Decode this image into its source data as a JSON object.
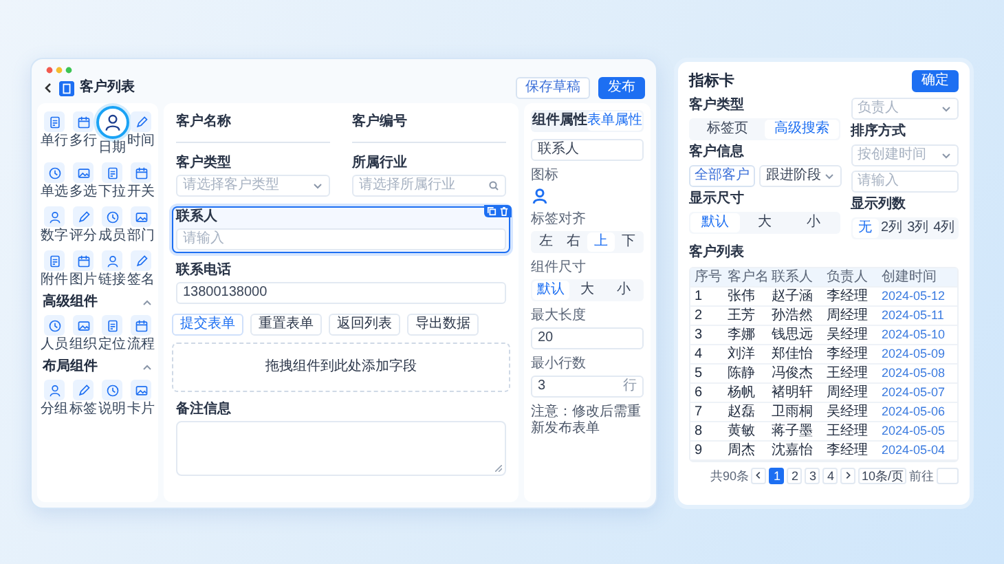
{
  "window": {
    "title": "客户列表",
    "buttons": [
      {
        "label": "保存草稿",
        "kind": "outline"
      },
      {
        "label": "发布",
        "kind": "primary"
      }
    ]
  },
  "palette": {
    "groups": [
      {
        "items": [
          {
            "label": "单行",
            "selected": false
          },
          {
            "label": "多行",
            "selected": false
          },
          {
            "label": "日期",
            "selected": true
          },
          {
            "label": "时间",
            "selected": false
          },
          {
            "label": "单选",
            "selected": false
          },
          {
            "label": "多选",
            "selected": false
          },
          {
            "label": "下拉",
            "selected": false
          },
          {
            "label": "开关",
            "selected": false
          },
          {
            "label": "数字",
            "selected": false
          },
          {
            "label": "评分",
            "selected": false
          },
          {
            "label": "成员",
            "selected": false
          },
          {
            "label": "部门",
            "selected": false
          },
          {
            "label": "附件",
            "selected": false
          },
          {
            "label": "图片",
            "selected": false
          },
          {
            "label": "链接",
            "selected": false
          },
          {
            "label": "签名",
            "selected": false
          }
        ]
      },
      {
        "title": "高级组件",
        "expanded": true,
        "items": [
          {
            "label": "人员",
            "selected": false
          },
          {
            "label": "组织",
            "selected": false
          },
          {
            "label": "定位",
            "selected": false
          },
          {
            "label": "流程",
            "selected": false
          }
        ]
      },
      {
        "title": "布局组件",
        "expanded": true,
        "items": [
          {
            "label": "分组",
            "selected": false
          },
          {
            "label": "标签",
            "selected": false
          },
          {
            "label": "说明",
            "selected": false
          },
          {
            "label": "卡片",
            "selected": false
          }
        ]
      }
    ]
  },
  "form": {
    "rows": [
      {
        "fields": [
          {
            "kind": "line",
            "label": "客户名称",
            "selected": false
          },
          {
            "kind": "line",
            "label": "客户编号",
            "selected": false
          }
        ]
      },
      {
        "fields": [
          {
            "kind": "select",
            "label": "客户类型",
            "placeholder": "请选择客户类型",
            "selected": false
          },
          {
            "kind": "search",
            "label": "所属行业",
            "placeholder": "请选择所属行业",
            "selected": false
          }
        ]
      },
      {
        "fields": [
          {
            "kind": "input",
            "label": "联系人",
            "placeholder": "请输入",
            "selected": true
          }
        ]
      },
      {
        "fields": [
          {
            "kind": "input",
            "label": "联系电话",
            "value": "13800138000",
            "selected": false
          }
        ]
      }
    ],
    "actions": [
      {
        "label": "提交表单",
        "selected": true
      },
      {
        "label": "重置表单",
        "selected": false
      },
      {
        "label": "返回列表",
        "selected": false
      },
      {
        "label": "导出数据",
        "selected": false
      }
    ],
    "drop_hint": "拖拽组件到此处添加字段",
    "textarea": {
      "label": "备注信息"
    }
  },
  "properties": {
    "tabs": [
      {
        "label": "组件属性",
        "selected": false
      },
      {
        "label": "表单属性",
        "selected": true
      }
    ],
    "items": [
      {
        "kind": "input",
        "value": "联系人"
      },
      {
        "kind": "icon",
        "label": "图标"
      },
      {
        "kind": "segmented",
        "label": "标签对齐",
        "options": [
          {
            "label": "左",
            "selected": false
          },
          {
            "label": "右",
            "selected": false
          },
          {
            "label": "上",
            "selected": true
          },
          {
            "label": "下",
            "selected": false
          }
        ]
      },
      {
        "kind": "segmented",
        "label": "组件尺寸",
        "options": [
          {
            "label": "默认",
            "selected": true
          },
          {
            "label": "大",
            "selected": false
          },
          {
            "label": "小",
            "selected": false
          }
        ]
      },
      {
        "kind": "input",
        "label": "最大长度",
        "value": "20"
      },
      {
        "kind": "stepper",
        "label": "最小行数",
        "value": "3",
        "unit": "行"
      },
      {
        "kind": "note",
        "text": "注意：修改后需重新发布表单"
      }
    ]
  },
  "card": {
    "title": "指标卡",
    "button": "确定",
    "left": [
      {
        "kind": "label",
        "text": "客户类型"
      },
      {
        "kind": "segmented",
        "options": [
          {
            "label": "标签页",
            "selected": false
          },
          {
            "label": "高级搜索",
            "selected": true
          }
        ]
      },
      {
        "kind": "label",
        "text": "客户信息"
      },
      {
        "kind": "pair",
        "button": "全部客户",
        "select": "跟进阶段"
      },
      {
        "kind": "label",
        "text": "显示尺寸"
      },
      {
        "kind": "segmented",
        "options": [
          {
            "label": "默认",
            "selected": true
          },
          {
            "label": "大",
            "selected": false
          },
          {
            "label": "小",
            "selected": false
          }
        ]
      }
    ],
    "right": [
      {
        "kind": "select",
        "placeholder": "负责人"
      },
      {
        "kind": "label",
        "text": "排序方式"
      },
      {
        "kind": "select",
        "placeholder": "按创建时间"
      },
      {
        "kind": "input",
        "placeholder": "请输入"
      },
      {
        "kind": "label",
        "text": "显示列数"
      },
      {
        "kind": "segmented",
        "options": [
          {
            "label": "无",
            "selected": true
          },
          {
            "label": "2列",
            "selected": false
          },
          {
            "label": "3列",
            "selected": false
          },
          {
            "label": "4列",
            "selected": false
          }
        ]
      }
    ],
    "table_title": "客户列表",
    "columns": [
      "序号",
      "客户名",
      "联系人",
      "负责人",
      "创建时间"
    ],
    "rows": [
      [
        "1",
        "张伟",
        "赵子涵",
        "李经理",
        "2024-05-12"
      ],
      [
        "2",
        "王芳",
        "孙浩然",
        "周经理",
        "2024-05-11"
      ],
      [
        "3",
        "李娜",
        "钱思远",
        "吴经理",
        "2024-05-10"
      ],
      [
        "4",
        "刘洋",
        "郑佳怡",
        "李经理",
        "2024-05-09"
      ],
      [
        "5",
        "陈静",
        "冯俊杰",
        "王经理",
        "2024-05-08"
      ],
      [
        "6",
        "杨帆",
        "褚明轩",
        "周经理",
        "2024-05-07"
      ],
      [
        "7",
        "赵磊",
        "卫雨桐",
        "吴经理",
        "2024-05-06"
      ],
      [
        "8",
        "黄敏",
        "蒋子墨",
        "王经理",
        "2024-05-05"
      ],
      [
        "9",
        "周杰",
        "沈嘉怡",
        "李经理",
        "2024-05-04"
      ]
    ],
    "pagination": {
      "total": "共90条",
      "pages": [
        {
          "label": "1",
          "selected": true
        },
        {
          "label": "2",
          "selected": false
        },
        {
          "label": "3",
          "selected": false
        },
        {
          "label": "4",
          "selected": false
        }
      ],
      "page_size": "10条/页",
      "goto": "前往"
    }
  }
}
